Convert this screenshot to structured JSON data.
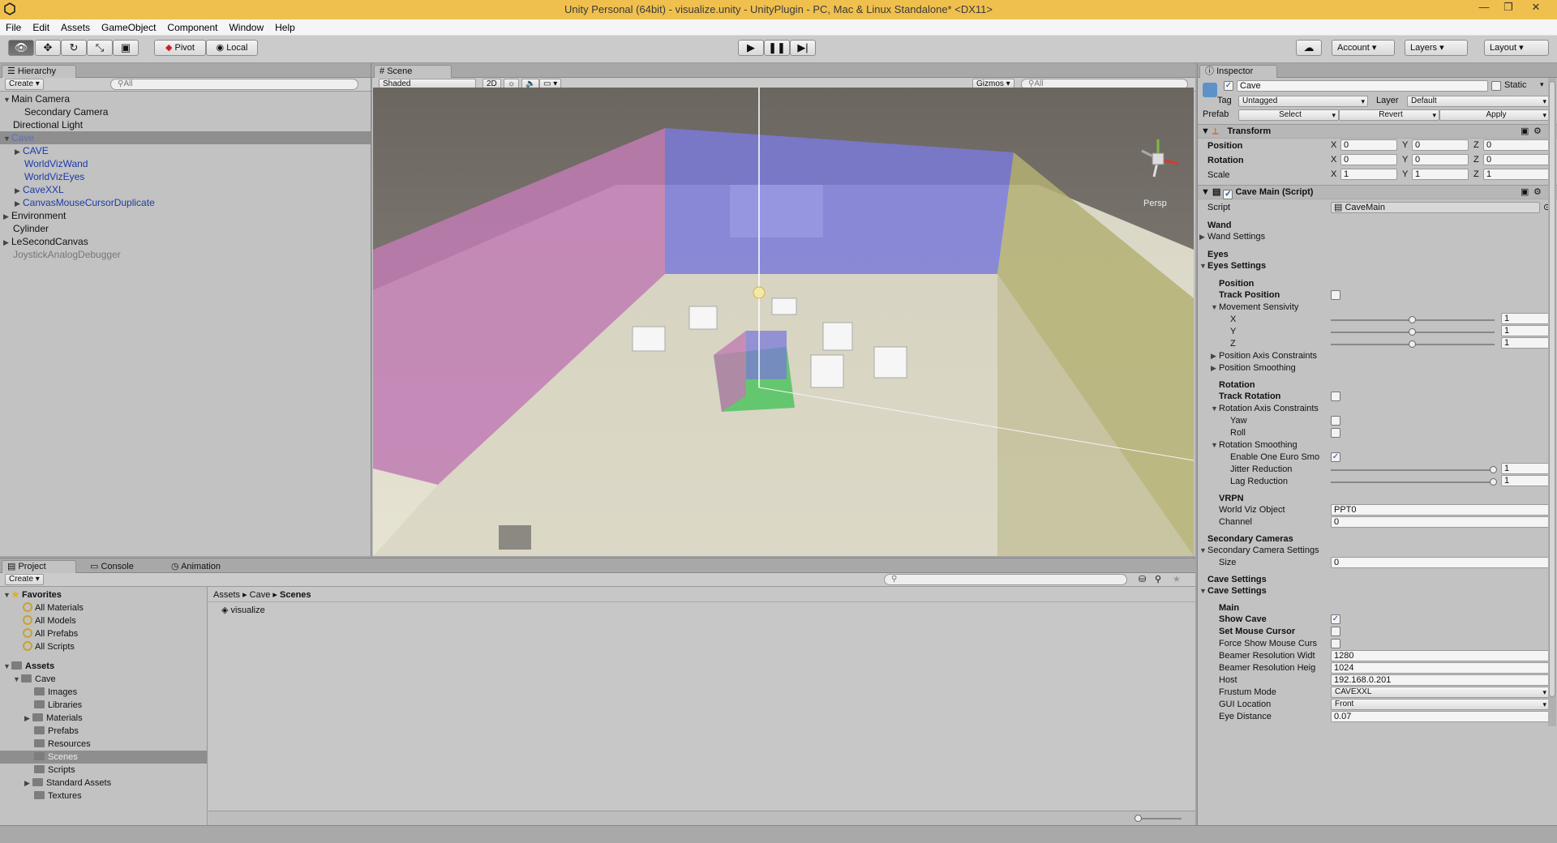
{
  "window": {
    "title": "Unity Personal (64bit) - visualize.unity - UnityPlugin - PC, Mac & Linux Standalone* <DX11>",
    "controls": [
      "—",
      "❐",
      "✕"
    ]
  },
  "menu": [
    "File",
    "Edit",
    "Assets",
    "GameObject",
    "Component",
    "Window",
    "Help"
  ],
  "toolbar": {
    "pivot_label": "Pivot",
    "local_label": "Local",
    "account_label": "Account",
    "layers_label": "Layers",
    "layout_label": "Layout"
  },
  "hierarchy": {
    "tab_label": "Hierarchy",
    "create_label": "Create",
    "search_placeholder": "All",
    "items": [
      {
        "label": "Main Camera",
        "expanded": true
      },
      {
        "label": "Secondary Camera"
      },
      {
        "label": "Directional Light"
      },
      {
        "label": "Cave",
        "expanded": true,
        "selected": true
      },
      {
        "label": "CAVE"
      },
      {
        "label": "WorldVizWand"
      },
      {
        "label": "WorldVizEyes"
      },
      {
        "label": "CaveXXL"
      },
      {
        "label": "CanvasMouseCursorDuplicate"
      },
      {
        "label": "Environment"
      },
      {
        "label": "Cylinder"
      },
      {
        "label": "LeSecondCanvas"
      },
      {
        "label": "JoystickAnalogDebugger"
      }
    ]
  },
  "scene": {
    "tab_label": "Scene",
    "shading_mode": "Shaded",
    "mode_2d": "2D",
    "gizmos_label": "Gizmos",
    "search_placeholder": "All",
    "camera_mode": "Persp"
  },
  "inspector": {
    "tab_label": "Inspector",
    "object_name": "Cave",
    "static_label": "Static",
    "tag_label": "Tag",
    "tag_value": "Untagged",
    "layer_label": "Layer",
    "layer_value": "Default",
    "prefab_label": "Prefab",
    "prefab_select": "Select",
    "prefab_revert": "Revert",
    "prefab_apply": "Apply",
    "transform": {
      "title": "Transform",
      "position_label": "Position",
      "position": [
        "0",
        "0",
        "0"
      ],
      "rotation_label": "Rotation",
      "rotation": [
        "0",
        "0",
        "0"
      ],
      "scale_label": "Scale",
      "scale": [
        "1",
        "1",
        "1"
      ],
      "axis_labels": [
        "X",
        "Y",
        "Z"
      ]
    },
    "script_component": {
      "title": "Cave Main (Script)",
      "script_label": "Script",
      "script_value": "CaveMain"
    },
    "wand_header": "Wand",
    "wand_settings": "Wand Settings",
    "eyes_header": "Eyes",
    "eyes_settings": "Eyes Settings",
    "position_header": "Position",
    "track_position": "Track Position",
    "movement_sensivity": "Movement Sensivity",
    "sens_axes": [
      "X",
      "Y",
      "Z"
    ],
    "sens_values": [
      "1",
      "1",
      "1"
    ],
    "position_axis_constraints": "Position Axis Constraints",
    "position_smoothing": "Position Smoothing",
    "rotation_header": "Rotation",
    "track_rotation": "Track Rotation",
    "rotation_axis_constraints": "Rotation Axis Constraints",
    "yaw": "Yaw",
    "roll": "Roll",
    "rotation_smoothing": "Rotation Smoothing",
    "enable_one_euro": "Enable One Euro Smo",
    "jitter_reduction": "Jitter Reduction",
    "jitter_value": "1",
    "lag_reduction": "Lag Reduction",
    "lag_value": "1",
    "vrpn_header": "VRPN",
    "world_viz_object": "World Viz Object",
    "world_viz_value": "PPT0",
    "channel": "Channel",
    "channel_value": "0",
    "secondary_cameras_header": "Secondary Cameras",
    "secondary_camera_settings": "Secondary Camera Settings",
    "size_label": "Size",
    "size_value": "0",
    "cave_settings_header": "Cave Settings",
    "cave_settings": "Cave Settings",
    "main_header": "Main",
    "show_cave": "Show Cave",
    "set_mouse_cursor": "Set Mouse Cursor",
    "force_show_mouse": "Force Show Mouse Curs",
    "beamer_width_label": "Beamer Resolution Widt",
    "beamer_width": "1280",
    "beamer_height_label": "Beamer Resolution Heig",
    "beamer_height": "1024",
    "host_label": "Host",
    "host_value": "192.168.0.201",
    "frustum_label": "Frustum Mode",
    "frustum_value": "CAVEXXL",
    "gui_location_label": "GUI Location",
    "gui_location_value": "Front",
    "eye_distance_label": "Eye Distance",
    "eye_distance_value": "0.07"
  },
  "project": {
    "tabs": [
      "Project",
      "Console",
      "Animation"
    ],
    "create_label": "Create",
    "favorites_label": "Favorites",
    "favorites": [
      "All Materials",
      "All Models",
      "All Prefabs",
      "All Scripts"
    ],
    "assets_label": "Assets",
    "tree": [
      {
        "label": "Cave",
        "depth": 1,
        "expanded": true
      },
      {
        "label": "Images",
        "depth": 2
      },
      {
        "label": "Libraries",
        "depth": 2
      },
      {
        "label": "Materials",
        "depth": 2,
        "collapsed": true
      },
      {
        "label": "Prefabs",
        "depth": 2
      },
      {
        "label": "Resources",
        "depth": 2
      },
      {
        "label": "Scenes",
        "depth": 2,
        "selected": true
      },
      {
        "label": "Scripts",
        "depth": 2
      },
      {
        "label": "Standard Assets",
        "depth": 1,
        "collapsed": true
      },
      {
        "label": "Textures",
        "depth": 1
      }
    ],
    "breadcrumb": [
      "Assets",
      "Cave",
      "Scenes"
    ],
    "files": [
      "visualize"
    ]
  },
  "colors": {
    "titlebar": "#f0c04f",
    "prefab_text": "#1c3aa8",
    "panel": "#c2c2c2"
  }
}
